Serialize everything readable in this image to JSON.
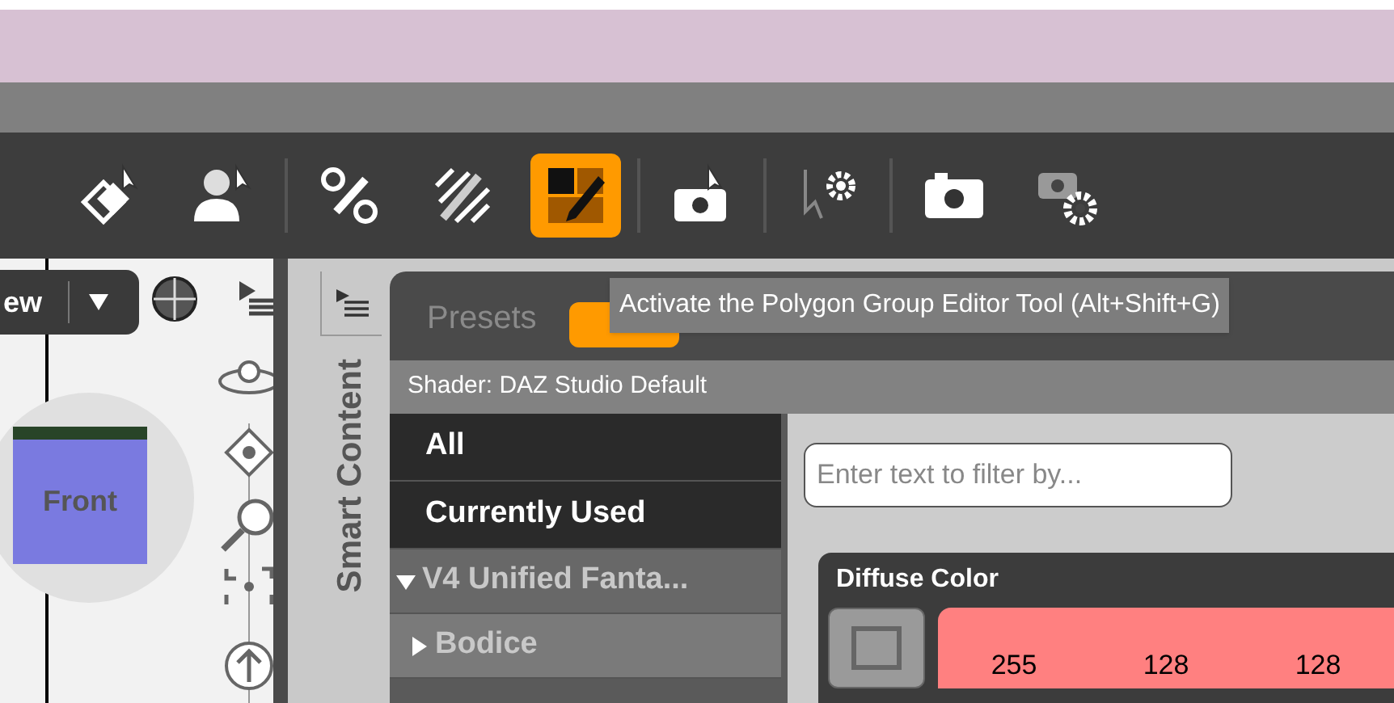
{
  "toolbar": {
    "groups": [
      [
        {
          "selected": false
        },
        {
          "selected": false
        }
      ],
      [
        {
          "selected": false
        },
        {
          "selected": false
        },
        {
          "selected": true
        }
      ],
      [
        {
          "selected": false
        }
      ],
      [
        {
          "selected": false
        }
      ],
      [
        {
          "selected": false
        },
        {
          "selected": false
        }
      ]
    ]
  },
  "viewport": {
    "view_button": "ew",
    "cube_label": "Front"
  },
  "side_tab": "Smart Content",
  "tabs": [
    {
      "label": "Presets",
      "selected": false
    },
    {
      "selected": true
    }
  ],
  "tooltip": "Activate the Polygon Group Editor Tool (Alt+Shift+G)",
  "shader_label": "Shader: DAZ Studio Default",
  "categories": [
    {
      "label": "All"
    },
    {
      "label": "Currently Used"
    }
  ],
  "tree": [
    {
      "label": "V4 Unified Fanta...",
      "expanded": true,
      "children": [
        {
          "label": "Bodice",
          "expanded": false
        }
      ]
    }
  ],
  "filter": {
    "placeholder": "Enter text to filter by..."
  },
  "property": {
    "title": "Diffuse Color",
    "color": "#ff8080",
    "values": [
      "255",
      "128",
      "128"
    ]
  }
}
